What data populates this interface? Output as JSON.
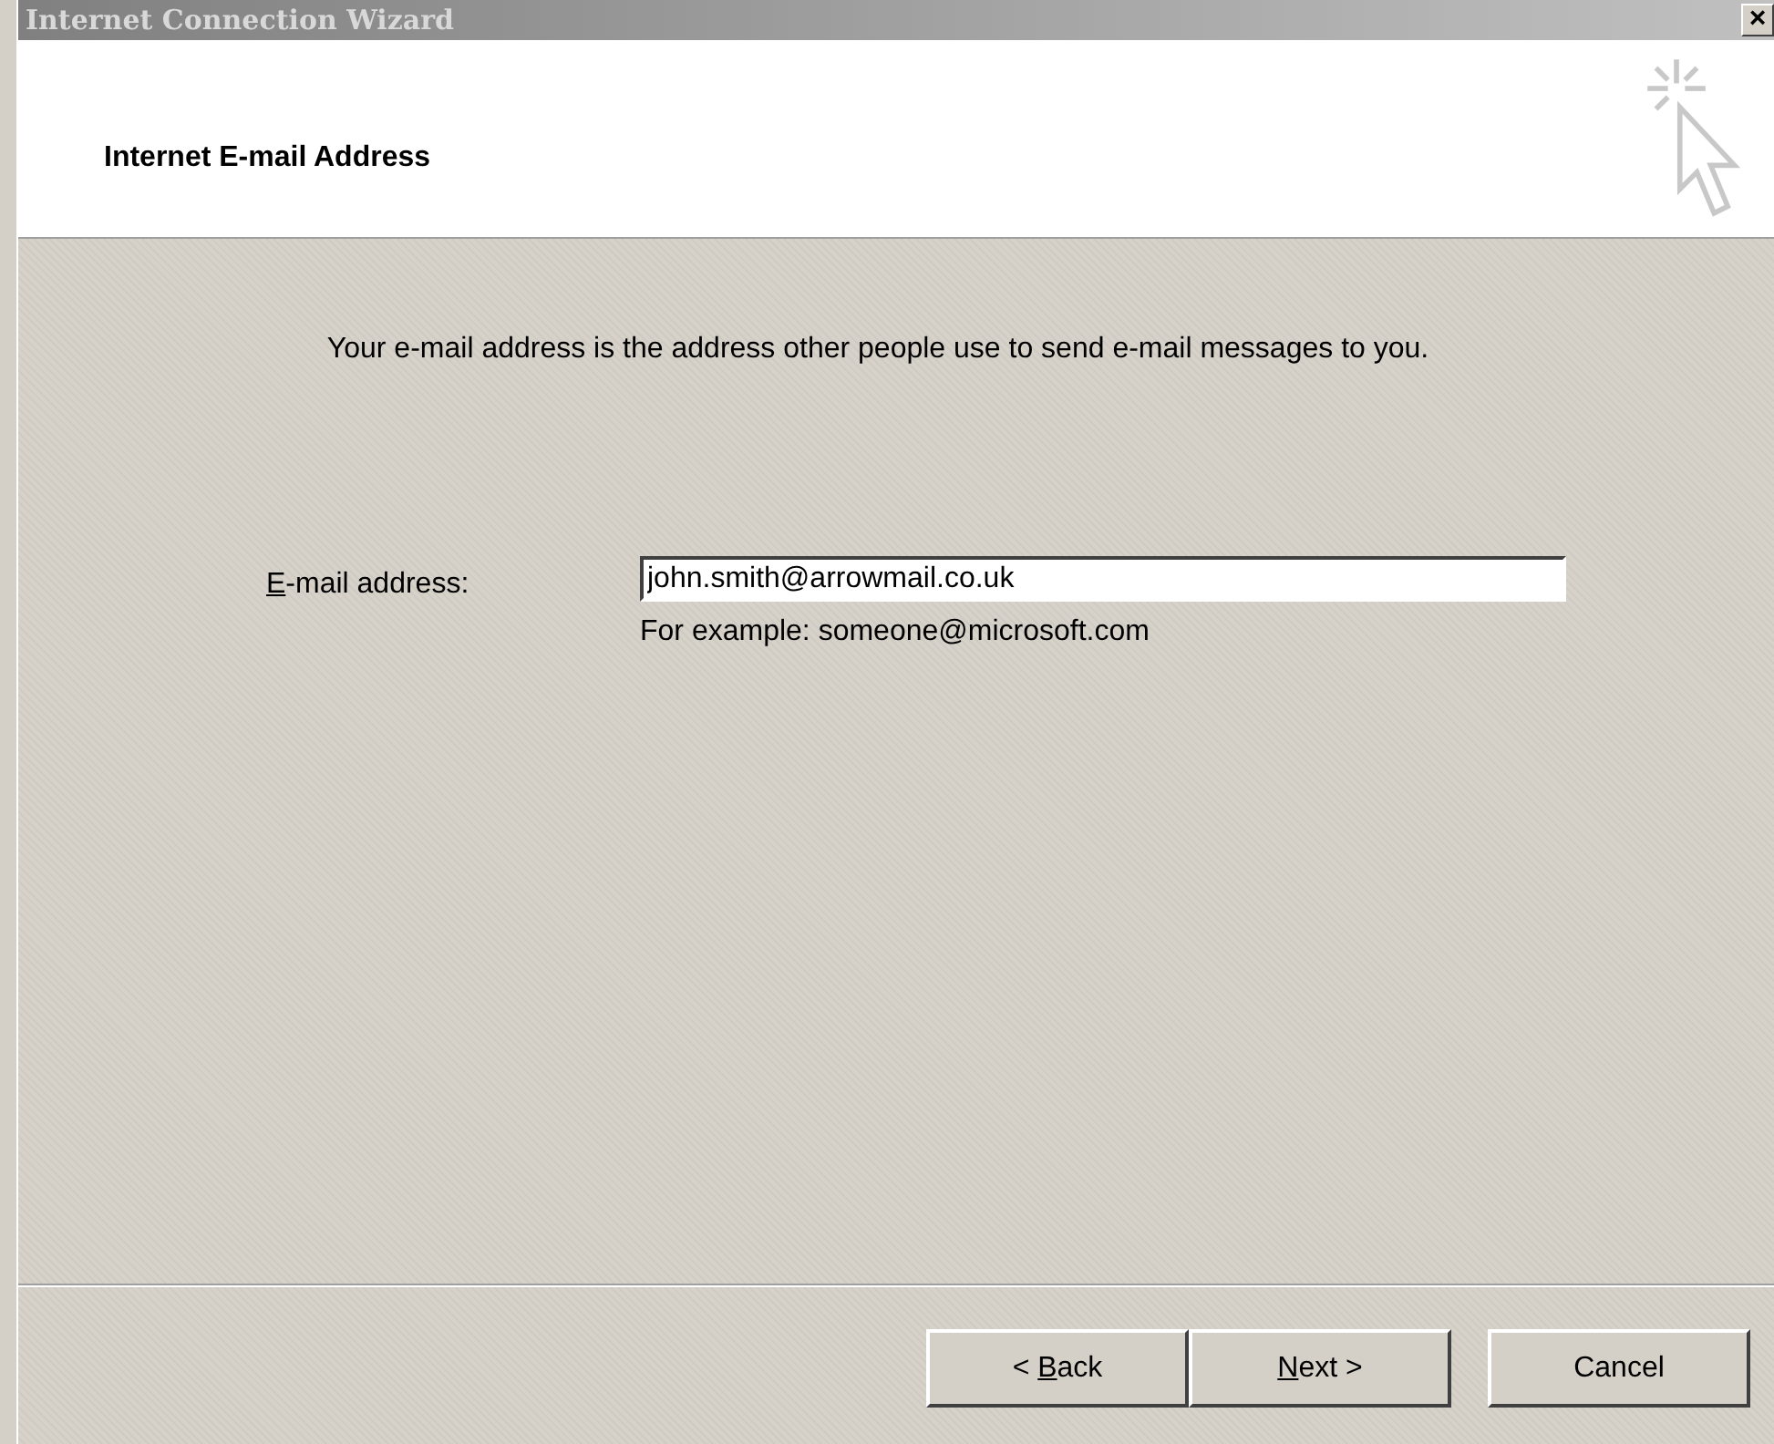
{
  "window": {
    "title": "Internet Connection Wizard",
    "close": "×"
  },
  "header": {
    "title": "Internet E-mail Address"
  },
  "description": "Your e-mail address is the address other people use to send e-mail messages to you.",
  "field": {
    "label": {
      "key": "E",
      "after": "-mail address:"
    },
    "value": "john.smith@arrowmail.co.uk",
    "hint": "For example: someone@microsoft.com"
  },
  "buttons": [
    {
      "before": "< ",
      "key": "B",
      "after": "ack"
    },
    {
      "key": "N",
      "after": "ext >"
    },
    {
      "before": "Cancel"
    }
  ]
}
